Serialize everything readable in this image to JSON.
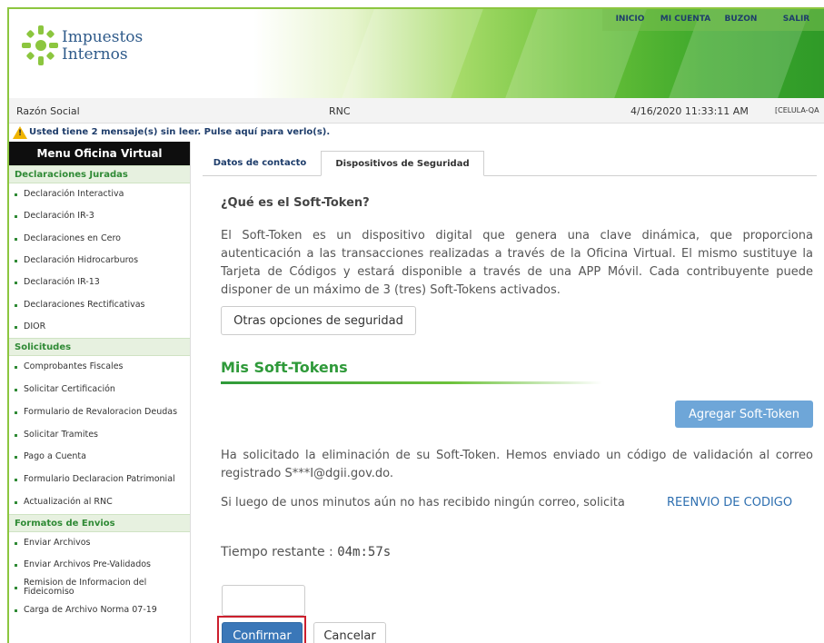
{
  "header": {
    "logo_line1": "Impuestos",
    "logo_line2": "Internos",
    "nav": [
      "INICIO",
      "MI CUENTA",
      "BUZON",
      "SALIR"
    ]
  },
  "infobar": {
    "razon_social_label": "Razón Social",
    "rnc_label": "RNC",
    "datetime": "4/16/2020 11:33:11 AM",
    "user": "[CELULA-QA"
  },
  "notice": "Usted tiene 2 mensaje(s) sin leer. Pulse aquí para verlo(s).",
  "sidebar": {
    "title": "Menu Oficina Virtual",
    "sections": [
      {
        "title": "Declaraciones Juradas",
        "items": [
          "Declaración Interactiva",
          "Declaración IR-3",
          "Declaraciones en Cero",
          "Declaración Hidrocarburos",
          "Declaración IR-13",
          "Declaraciones Rectificativas",
          "DIOR"
        ]
      },
      {
        "title": "Solicitudes",
        "items": [
          "Comprobantes Fiscales",
          "Solicitar Certificación",
          "Formulario de Revaloracion Deudas",
          "Solicitar Tramites",
          "Pago a Cuenta",
          "Formulario Declaracion Patrimonial",
          "Actualización al RNC"
        ]
      },
      {
        "title": "Formatos de Envios",
        "items": [
          "Enviar Archivos",
          "Enviar Archivos Pre-Validados",
          "Remision de Informacion del Fideicomiso",
          "Carga de Archivo Norma 07-19"
        ]
      }
    ]
  },
  "tabs": [
    "Datos de contacto",
    "Dispositivos de Seguridad"
  ],
  "active_tab": "Dispositivos de Seguridad",
  "main": {
    "question": "¿Qué es el Soft-Token?",
    "description": "El Soft-Token es un dispositivo digital que genera una clave dinámica, que proporciona autenticación a las transacciones realizadas a través de la Oficina Virtual. El mismo sustituye la Tarjeta de Códigos y estará disponible a través de una APP Móvil. Cada contribuyente puede disponer de un máximo de 3 (tres) Soft-Tokens activados.",
    "other_options_button": "Otras opciones de seguridad",
    "section_title": "Mis Soft-Tokens",
    "add_button": "Agregar Soft-Token",
    "removal_message": "Ha solicitado la eliminación de su Soft-Token. Hemos enviado un código de validación al correo registrado S***I@dgii.gov.do.",
    "resend_prompt": "Si luego de unos minutos aún no has recibido ningún correo, solicita",
    "resend_link": "REENVIO DE CODIGO",
    "timer_label": "Tiempo restante :",
    "timer_value": "04m:57s",
    "code_value": "",
    "confirm_button": "Confirmar",
    "cancel_button": "Cancelar"
  },
  "colors": {
    "brand_green": "#2f9a3a",
    "navy": "#1e3d6b",
    "primary_blue": "#3a77b8",
    "highlight_red": "#cc1f2d"
  }
}
